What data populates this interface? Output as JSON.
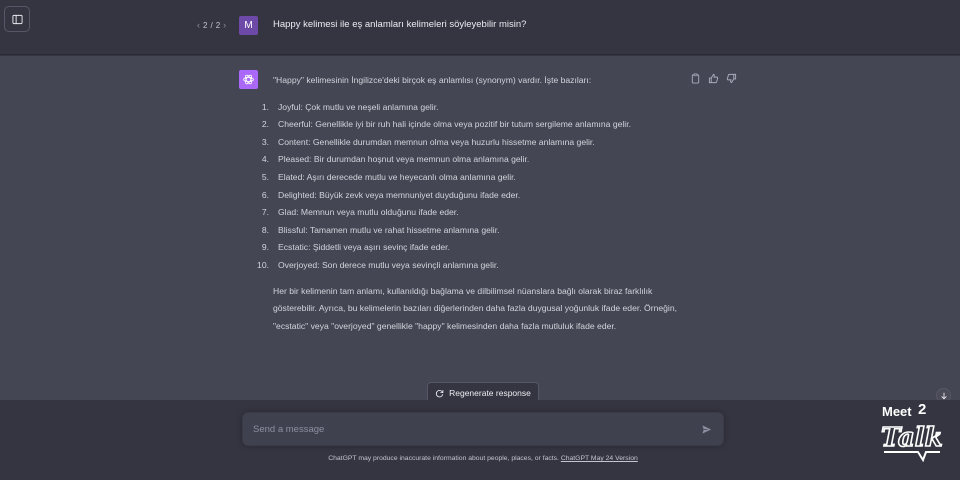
{
  "user_turn": {
    "pager": {
      "current": "2",
      "separator": "/",
      "total": "2"
    },
    "avatar_letter": "M",
    "message": "Happy kelimesi ile eş anlamları kelimeleri söyleyebilir misin?"
  },
  "assistant_turn": {
    "intro": "\"Happy\" kelimesinin İngilizce'deki birçok eş anlamlısı (synonym) vardır. İşte bazıları:",
    "items": [
      {
        "num": "1.",
        "text": "Joyful: Çok mutlu ve neşeli anlamına gelir."
      },
      {
        "num": "2.",
        "text": "Cheerful: Genellikle iyi bir ruh hali içinde olma veya pozitif bir tutum sergileme anlamına gelir."
      },
      {
        "num": "3.",
        "text": "Content: Genellikle durumdan memnun olma veya huzurlu hissetme anlamına gelir."
      },
      {
        "num": "4.",
        "text": "Pleased: Bir durumdan hoşnut veya memnun olma anlamına gelir."
      },
      {
        "num": "5.",
        "text": "Elated: Aşırı derecede mutlu ve heyecanlı olma anlamına gelir."
      },
      {
        "num": "6.",
        "text": "Delighted: Büyük zevk veya memnuniyet duyduğunu ifade eder."
      },
      {
        "num": "7.",
        "text": "Glad: Memnun veya mutlu olduğunu ifade eder."
      },
      {
        "num": "8.",
        "text": "Blissful: Tamamen mutlu ve rahat hissetme anlamına gelir."
      },
      {
        "num": "9.",
        "text": "Ecstatic: Şiddetli veya aşırı sevinç ifade eder."
      },
      {
        "num": "10.",
        "text": "Overjoyed: Son derece mutlu veya sevinçli anlamına gelir."
      }
    ],
    "summary": "Her bir kelimenin tam anlamı, kullanıldığı bağlama ve dilbilimsel nüanslara bağlı olarak biraz farklılık gösterebilir. Ayrıca, bu kelimelerin bazıları diğerlerinden daha fazla duygusal yoğunluk ifade eder. Örneğin, \"ecstatic\" veya \"overjoyed\" genellikle \"happy\" kelimesinden daha fazla mutluluk ifade eder."
  },
  "regenerate_label": "Regenerate response",
  "composer": {
    "placeholder": "Send a message",
    "value": ""
  },
  "footer": {
    "note": "ChatGPT may produce inaccurate information about people, places, or facts.",
    "version_link": "ChatGPT May 24 Version"
  },
  "watermark": {
    "line1": "Meet",
    "superscript": "2",
    "line2": "Talk"
  },
  "colors": {
    "background": "#343541",
    "assistant_background": "#444654",
    "user_avatar": "#6e4aa8",
    "gpt_avatar": "#ab68ff",
    "input_background": "#40414f"
  },
  "icons": {
    "sidebar_toggle": "sidebar-toggle-icon",
    "pager_prev": "chevron-left-icon",
    "pager_next": "chevron-right-icon",
    "gpt_avatar": "openai-logo-icon",
    "copy": "clipboard-icon",
    "thumbs_up": "thumbs-up-icon",
    "thumbs_down": "thumbs-down-icon",
    "regenerate": "refresh-icon",
    "send": "paper-plane-icon",
    "scroll_down": "arrow-down-icon"
  }
}
